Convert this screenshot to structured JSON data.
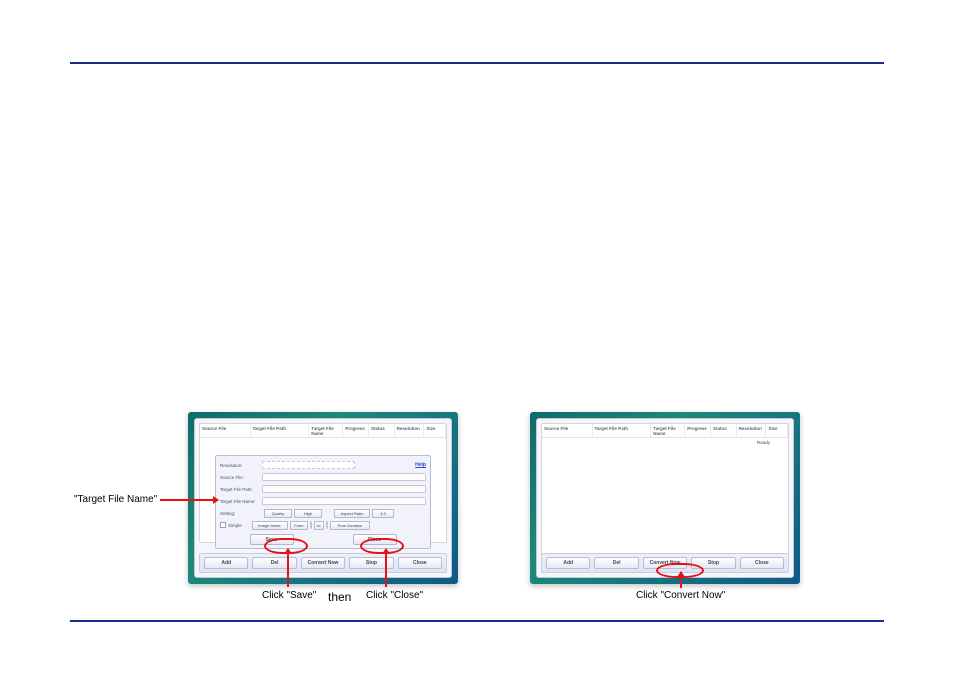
{
  "callouts": {
    "target_file_name": "\"Target File Name\"",
    "click_save": "Click \"Save\"",
    "click_close": "Click \"Close\"",
    "click_convert": "Click \"Convert Now\"",
    "then": "then"
  },
  "columns": {
    "source": "Source File",
    "target_path": "Target File Path",
    "target_name": "Target File Name",
    "progress": "Progress",
    "status": "Status",
    "resolution": "Resolution",
    "size": "Size"
  },
  "status_ready": "Ready",
  "dialog": {
    "resolution": "Resolution:",
    "source_file": "Source File:",
    "target_path": "Target File Path:",
    "target_name": "Target File Name:",
    "setting": "Setting:",
    "simple": "Simple",
    "quality": "Quality",
    "high": "High",
    "aspect": "Aspect Ratio",
    "ratio": "4:3",
    "image_items": "Image Items:",
    "from": "From",
    "to": "to",
    "time_duration": "Time Duration",
    "help": "Help",
    "save_btn": "Save",
    "close_btn": "Close"
  },
  "bottom_buttons": {
    "add": "Add",
    "del": "Del",
    "convert": "Convert Now",
    "stop": "Stop",
    "close": "Close"
  }
}
